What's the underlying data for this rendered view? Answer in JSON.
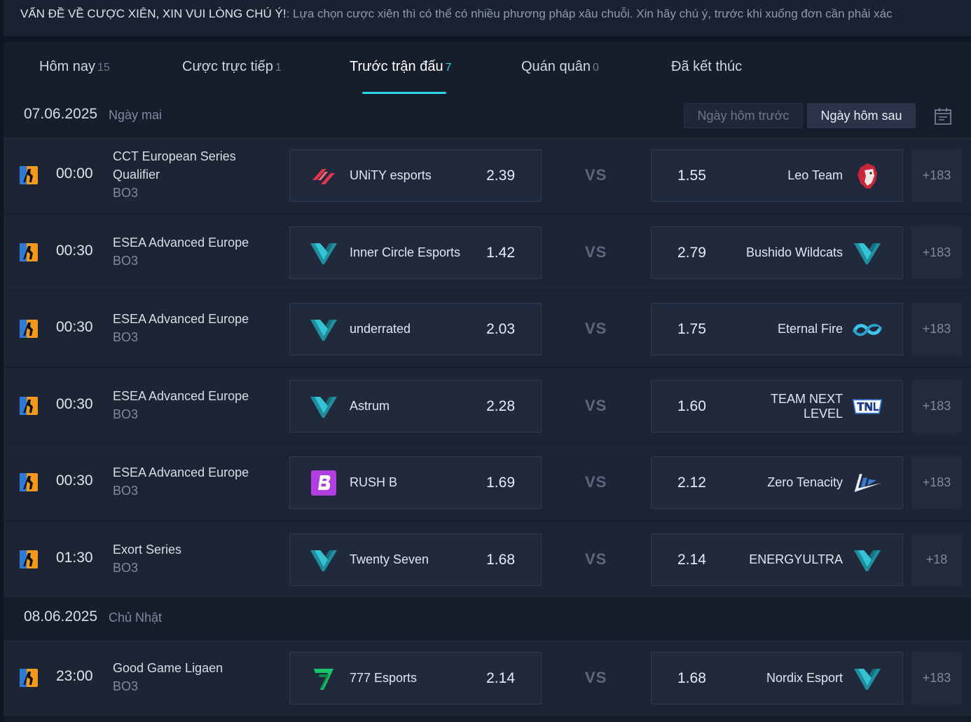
{
  "notice": {
    "title": "VẤN ĐỀ VỀ CƯỢC XIÊN, XIN VUI LÒNG CHÚ Ý!",
    "body": ": Lựa chọn cược xiên thì có thể có nhiều phương pháp xâu chuỗi. Xin hãy chú ý, trước khi xuống đơn cần phải xác"
  },
  "tabs": [
    {
      "label": "Hôm nay",
      "count": "15"
    },
    {
      "label": "Cược trực tiếp",
      "count": "1"
    },
    {
      "label": "Trước trận đấu",
      "count": "7"
    },
    {
      "label": "Quán quân",
      "count": "0"
    },
    {
      "label": "Đã kết thúc",
      "count": ""
    }
  ],
  "nav": {
    "prev_day": "Ngày hôm trước",
    "next_day": "Ngày hôm sau"
  },
  "days": [
    {
      "date": "07.06.2025",
      "day_name": "Ngày mai",
      "matches": [
        {
          "time": "00:00",
          "league": "CCT European Series Qualifier",
          "format": "BO3",
          "home": {
            "name": "UNiTY esports",
            "odds": "2.39"
          },
          "away": {
            "name": "Leo Team",
            "odds": "1.55"
          },
          "more": "+183"
        },
        {
          "time": "00:30",
          "league": "ESEA Advanced Europe",
          "format": "BO3",
          "home": {
            "name": "Inner Circle Esports",
            "odds": "1.42"
          },
          "away": {
            "name": "Bushido Wildcats",
            "odds": "2.79"
          },
          "more": "+183"
        },
        {
          "time": "00:30",
          "league": "ESEA Advanced Europe",
          "format": "BO3",
          "home": {
            "name": "underrated",
            "odds": "2.03"
          },
          "away": {
            "name": "Eternal Fire",
            "odds": "1.75"
          },
          "more": "+183"
        },
        {
          "time": "00:30",
          "league": "ESEA Advanced Europe",
          "format": "BO3",
          "home": {
            "name": "Astrum",
            "odds": "2.28"
          },
          "away": {
            "name": "TEAM NEXT LEVEL",
            "odds": "1.60"
          },
          "more": "+183"
        },
        {
          "time": "00:30",
          "league": "ESEA Advanced Europe",
          "format": "BO3",
          "home": {
            "name": "RUSH B",
            "odds": "1.69"
          },
          "away": {
            "name": "Zero Tenacity",
            "odds": "2.12"
          },
          "more": "+183"
        },
        {
          "time": "01:30",
          "league": "Exort Series",
          "format": "BO3",
          "home": {
            "name": "Twenty Seven",
            "odds": "1.68"
          },
          "away": {
            "name": "ENERGYULTRA",
            "odds": "2.14"
          },
          "more": "+18"
        }
      ]
    },
    {
      "date": "08.06.2025",
      "day_name": "Chủ Nhật",
      "matches": [
        {
          "time": "23:00",
          "league": "Good Game Ligaen",
          "format": "BO3",
          "home": {
            "name": "777 Esports",
            "odds": "2.14"
          },
          "away": {
            "name": "Nordix Esport",
            "odds": "1.68"
          },
          "more": "+183"
        }
      ]
    }
  ],
  "vs_label": "VS"
}
